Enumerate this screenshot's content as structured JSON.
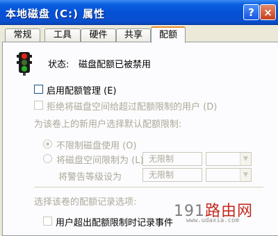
{
  "window": {
    "title": "本地磁盘 (C:) 属性",
    "help_label": "?",
    "close_label": "×"
  },
  "tabs": [
    {
      "label": "常规"
    },
    {
      "label": "工具"
    },
    {
      "label": "硬件"
    },
    {
      "label": "共享"
    },
    {
      "label": "配额"
    }
  ],
  "active_tab": "配额",
  "quota": {
    "status_label": "状态:",
    "status_value": "磁盘配额已被禁用",
    "enable_label": "启用配额管理 (E)",
    "deny_label": "拒绝将磁盘空间给超过配额限制的用户 (D)",
    "default_section_label": "为该卷上的新用户选择默认配额限制:",
    "no_limit_label": "不限制磁盘使用 (O)",
    "limit_label": "将磁盘空间限制为 (L)",
    "limit_value": "无限制",
    "warning_label": "将警告等级设为",
    "warning_value": "无限制",
    "log_section_label": "选择该卷的配额记录选项:",
    "log_exceed_label": "用户超出配额限制时记录事件"
  },
  "watermark": {
    "logo_prefix": "191",
    "logo_suffix": "路由网",
    "url": "www.udaxia.com"
  },
  "colors": {
    "title_bar": "#0550d6",
    "active_tab_accent": "#e68b2c",
    "disabled_text": "#aca899"
  }
}
